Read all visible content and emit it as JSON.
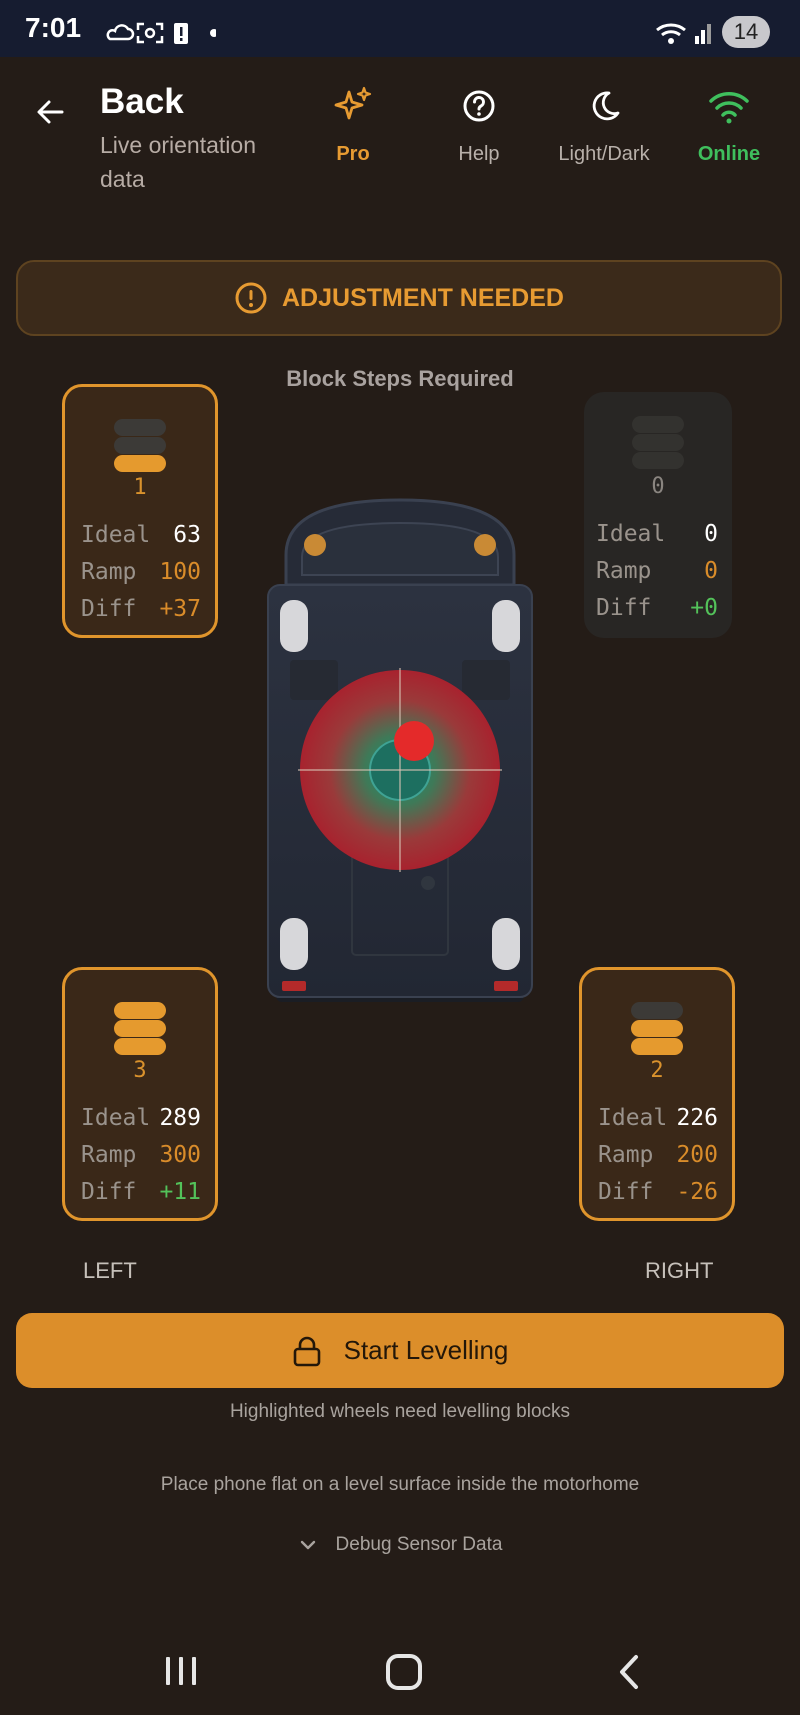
{
  "status_bar": {
    "time": "7:01",
    "battery_badge": "14",
    "icons": [
      "cloud-icon",
      "screenshot-icon",
      "alert-battery-icon",
      "dot-icon",
      "wifi-icon",
      "signal-icon"
    ]
  },
  "header": {
    "title": "Back",
    "subtitle": "Live orientation data",
    "actions": [
      {
        "label": "Pro",
        "icon": "sparkle-icon",
        "color": "#e79b32"
      },
      {
        "label": "Help",
        "icon": "help-circle-icon",
        "color": "#b8b0aa"
      },
      {
        "label": "Light/Dark",
        "icon": "moon-icon",
        "color": "#b8b0aa"
      },
      {
        "label": "Online",
        "icon": "wifi-icon",
        "color": "#3fbf5d"
      }
    ]
  },
  "banner": {
    "text": "ADJUSTMENT NEEDED",
    "icon": "alert-circle-icon",
    "color": "#e79b32"
  },
  "block_steps_title": "Block Steps Required",
  "wheels": {
    "front_left": {
      "blocks_on": 1,
      "count": "1",
      "ideal": "63",
      "ramp": "100",
      "diff": "+37",
      "active": true
    },
    "front_right": {
      "blocks_on": 0,
      "count": "0",
      "ideal": "0",
      "ramp": "0",
      "diff": "+0",
      "active": false
    },
    "rear_left": {
      "blocks_on": 3,
      "count": "3",
      "ideal": "289",
      "ramp": "300",
      "diff": "+11",
      "active": true
    },
    "rear_right": {
      "blocks_on": 2,
      "count": "2",
      "ideal": "226",
      "ramp": "200",
      "diff": "-26",
      "active": true
    }
  },
  "row_labels": {
    "ideal": "Ideal",
    "ramp": "Ramp",
    "diff": "Diff"
  },
  "side_labels": {
    "left": "LEFT",
    "right": "RIGHT"
  },
  "primary_button": {
    "label": "Start Levelling",
    "icon": "lock-icon"
  },
  "notes": {
    "highlight": "Highlighted wheels need levelling blocks",
    "instruction": "Place phone flat on a level surface inside the motorhome"
  },
  "debug_toggle": "Debug Sensor Data",
  "nav_bar": [
    "recent-apps-icon",
    "home-icon",
    "back-icon"
  ]
}
